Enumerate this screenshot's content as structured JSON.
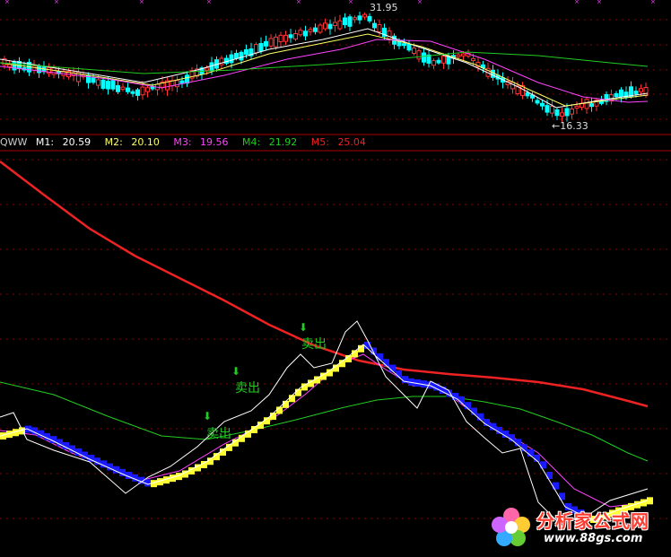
{
  "chart_data": [
    {
      "type": "candlestick",
      "panel": "price",
      "annotations": {
        "high_label": "31.95",
        "low_label": "←16.33"
      },
      "high": 31.95,
      "low": 16.33
    },
    {
      "type": "line",
      "panel": "indicator",
      "indicator_name": "QWW",
      "legend": [
        {
          "label": "M1:",
          "value": "20.59",
          "color": "#ffffff"
        },
        {
          "label": "M2:",
          "value": "20.10",
          "color": "#ffff66"
        },
        {
          "label": "M3:",
          "value": "19.56",
          "color": "#ff44ff"
        },
        {
          "label": "M4:",
          "value": "21.92",
          "color": "#22cc22"
        },
        {
          "label": "M5:",
          "value": "25.04",
          "color": "#ee2222"
        }
      ],
      "signals": [
        "卖出",
        "卖出",
        "卖出"
      ],
      "signal_color": "#22cc22"
    }
  ],
  "watermark": {
    "text": "分析家公式网",
    "url": "www.88gs.com"
  },
  "colors": {
    "up": "#ff3333",
    "down": "#00ffff",
    "grid": "#8b0000",
    "panel_border": "#b00000",
    "bar_yellow": "#ffff33",
    "bar_blue": "#1a1aff"
  }
}
